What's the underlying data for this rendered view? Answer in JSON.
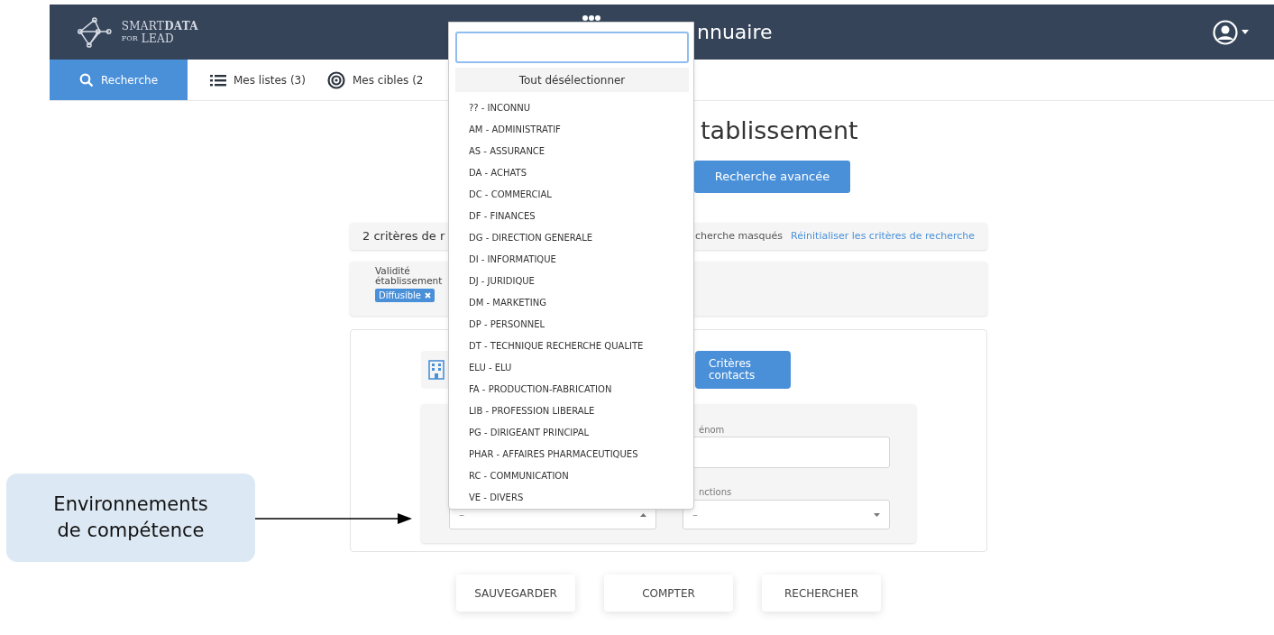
{
  "header": {
    "logo_top": "SMART**DATA**",
    "logo_small": "FOR",
    "logo_bottom": "LEAD",
    "title": "nnuaire"
  },
  "tabs": [
    {
      "label": "Recherche",
      "selected": true
    },
    {
      "label": "Mes listes (3)",
      "selected": false
    },
    {
      "label": "Mes cibles (2",
      "selected": false
    }
  ],
  "page_title": "tablissement",
  "advanced_button": "Recherche avancée",
  "criteria_bar": {
    "count_text": "2 critères de r",
    "hidden_text": "cherche masqués",
    "reset_link": "Réinitialiser les critères de recherche"
  },
  "active_criteria": [
    {
      "label": "Validité établissement",
      "tags": [
        "Diffusible"
      ]
    }
  ],
  "criteria_tabs": [
    {
      "kind": "icon",
      "selected": false
    },
    {
      "kind": "label",
      "label": "Critères contacts",
      "selected": true
    }
  ],
  "form": {
    "text_field": {
      "label": "énom"
    },
    "functions_select": {
      "label": "nctions",
      "value": "–",
      "expanded": false
    },
    "competence_select": {
      "value": "–",
      "expanded": true
    }
  },
  "dropdown": {
    "deselect_all": "Tout désélectionner",
    "options": [
      "?? - INCONNU",
      "AM - ADMINISTRATIF",
      "AS - ASSURANCE",
      "DA - ACHATS",
      "DC - COMMERCIAL",
      "DF - FINANCES",
      "DG - DIRECTION GENERALE",
      "DI - INFORMATIQUE",
      "DJ - JURIDIQUE",
      "DM - MARKETING",
      "DP - PERSONNEL",
      "DT - TECHNIQUE RECHERCHE QUALITE",
      "ELU - ELU",
      "FA - PRODUCTION-FABRICATION",
      "LIB - PROFESSION LIBERALE",
      "PG - DIRIGEANT PRINCIPAL",
      "PHAR - AFFAIRES PHARMACEUTIQUES",
      "RC - COMMUNICATION",
      "VE - DIVERS"
    ]
  },
  "buttons": [
    "SAUVEGARDER",
    "COMPTER",
    "RECHERCHER"
  ],
  "callout": {
    "text": "Environnements\nde compétence"
  }
}
